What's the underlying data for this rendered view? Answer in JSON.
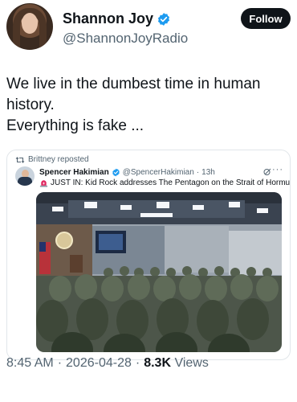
{
  "author": {
    "name": "Shannon Joy",
    "handle": "@ShannonJoyRadio",
    "follow_label": "Follow"
  },
  "tweet": {
    "line1": "We live in the dumbest time in human",
    "line2": "history.",
    "line3": "Everything is fake ..."
  },
  "quote": {
    "repost_label": "Brittney reposted",
    "author_name": "Spencer Hakimian",
    "author_handle": "@SpencerHakimian",
    "separator": "·",
    "time": "13h",
    "more": "···",
    "text": "JUST IN: Kid Rock addresses The Pentagon on the Strait of Hormuz."
  },
  "meta": {
    "time": "8:45 AM",
    "dot1": "·",
    "date": "2026-04-28",
    "dot2": "·",
    "views_count": "8.3K",
    "views_label": "Views"
  },
  "colors": {
    "verified": "#1d9bf0",
    "text_primary": "#0f1419",
    "text_secondary": "#536471"
  }
}
